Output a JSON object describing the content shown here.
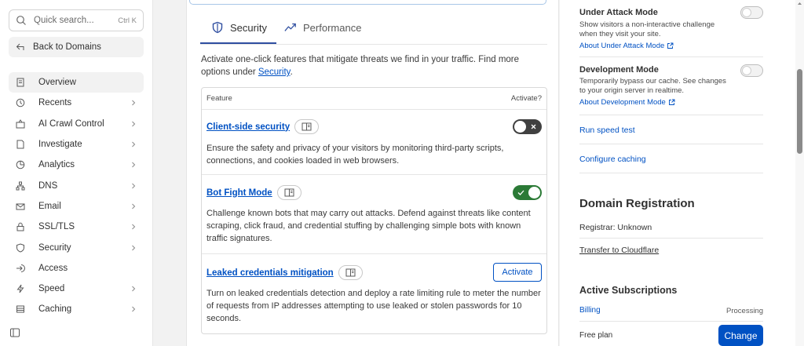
{
  "sidebar": {
    "search_placeholder": "Quick search...",
    "search_shortcut": "Ctrl K",
    "back_label": "Back to Domains",
    "items": [
      {
        "label": "Overview",
        "icon": "document-icon",
        "active": true,
        "chevron": false
      },
      {
        "label": "Recents",
        "icon": "clock-icon",
        "chevron": true
      },
      {
        "label": "AI Crawl Control",
        "icon": "crawl-icon",
        "chevron": true
      },
      {
        "label": "Investigate",
        "icon": "report-icon",
        "chevron": true
      },
      {
        "label": "Analytics",
        "icon": "chart-icon",
        "chevron": true
      },
      {
        "label": "DNS",
        "icon": "network-icon",
        "chevron": true
      },
      {
        "label": "Email",
        "icon": "mail-icon",
        "chevron": true
      },
      {
        "label": "SSL/TLS",
        "icon": "lock-icon",
        "chevron": true
      },
      {
        "label": "Security",
        "icon": "shield-icon",
        "chevron": true
      },
      {
        "label": "Access",
        "icon": "access-icon",
        "chevron": false
      },
      {
        "label": "Speed",
        "icon": "bolt-icon",
        "chevron": true
      },
      {
        "label": "Caching",
        "icon": "caching-icon",
        "chevron": true
      }
    ]
  },
  "main": {
    "tabs": [
      {
        "label": "Security",
        "icon": "shield-icon",
        "active": true
      },
      {
        "label": "Performance",
        "icon": "trend-icon",
        "active": false
      }
    ],
    "intro_text": "Activate one-click features that mitigate threats we find in your traffic. Find more options under ",
    "intro_link": "Security",
    "intro_end": ".",
    "table": {
      "col_feature": "Feature",
      "col_activate": "Activate?",
      "rows": [
        {
          "name": "Client-side security",
          "description": "Ensure the safety and privacy of your visitors by monitoring third-party scripts, connections, and cookies loaded in web browsers.",
          "state": "off"
        },
        {
          "name": "Bot Fight Mode",
          "description": "Challenge known bots that may carry out attacks. Defend against threats like content scraping, click fraud, and credential stuffing by challenging simple bots with known traffic signatures.",
          "state": "on"
        },
        {
          "name": "Leaked credentials mitigation",
          "description": "Turn on leaked credentials detection and deploy a rate limiting rule to meter the number of requests from IP addresses attempting to use leaked or stolen passwords for 10 seconds.",
          "action_label": "Activate"
        }
      ]
    }
  },
  "right": {
    "under_attack": {
      "title": "Under Attack Mode",
      "description": "Show visitors a non-interactive challenge when they visit your site.",
      "link": "About Under Attack Mode"
    },
    "dev_mode": {
      "title": "Development Mode",
      "description": "Temporarily bypass our cache. See changes to your origin server in realtime.",
      "link": "About Development Mode"
    },
    "speed_test": "Run speed test",
    "configure_caching": "Configure caching",
    "domain_registration": {
      "heading": "Domain Registration",
      "registrar": "Registrar: Unknown",
      "transfer": "Transfer to Cloudflare"
    },
    "subscriptions": {
      "heading": "Active Subscriptions",
      "billing": "Billing",
      "status": "Processing",
      "plan": "Free plan",
      "change": "Change"
    }
  },
  "colors": {
    "link": "#0051c3",
    "toggle_on": "#2b7a36",
    "toggle_off": "#404040",
    "primary_button": "#0051c3"
  }
}
